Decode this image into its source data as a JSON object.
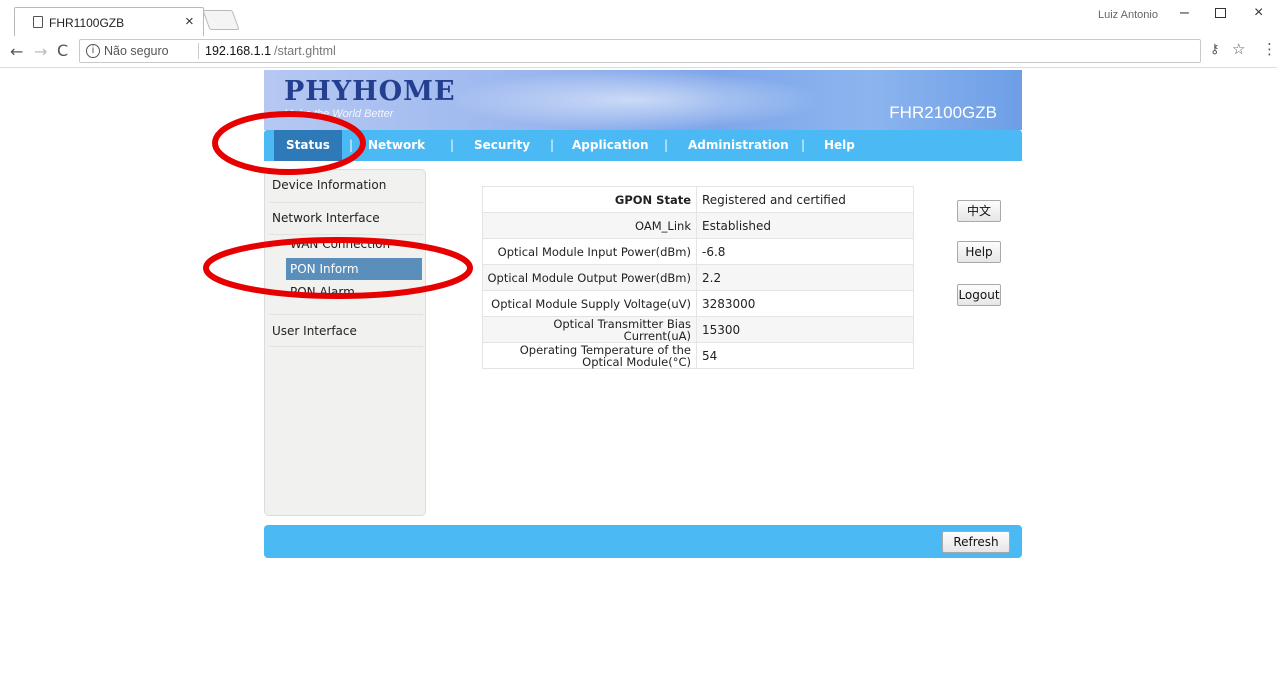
{
  "browser": {
    "tab_title": "FHR1100GZB",
    "tab_close": "×",
    "profile_name": "Luiz Antonio",
    "window_min": "–",
    "window_close": "×",
    "security_label": "Não seguro",
    "url_host": "192.168.1.1",
    "url_path": "/start.ghtml"
  },
  "banner": {
    "logo": "PHYHOME",
    "slogan": "Make the World Better",
    "model": "FHR2100GZB"
  },
  "menu": {
    "items": [
      "Status",
      "Network",
      "Security",
      "Application",
      "Administration",
      "Help"
    ],
    "separator": "|",
    "active": "Status"
  },
  "sidebar": {
    "device_information": "Device Information",
    "network_interface": "Network Interface",
    "wan_connection": "WAN Connection",
    "pon_inform": "PON Inform",
    "pon_alarm": "PON Alarm",
    "user_interface": "User Interface"
  },
  "pon_table": [
    {
      "label": "GPON State",
      "value": "Registered and certified"
    },
    {
      "label": "OAM_Link",
      "value": "Established"
    },
    {
      "label": "Optical Module Input Power(dBm)",
      "value": "-6.8"
    },
    {
      "label": "Optical Module Output Power(dBm)",
      "value": "2.2"
    },
    {
      "label": "Optical Module Supply Voltage(uV)",
      "value": "3283000"
    },
    {
      "label": "Optical Transmitter Bias Current(uA)",
      "value": "15300"
    },
    {
      "label": "Operating Temperature of the Optical Module(°C)",
      "value": "54"
    }
  ],
  "buttons": {
    "chinese": "中文",
    "help": "Help",
    "logout": "Logout",
    "refresh": "Refresh"
  },
  "annotation_color": "#e60000"
}
